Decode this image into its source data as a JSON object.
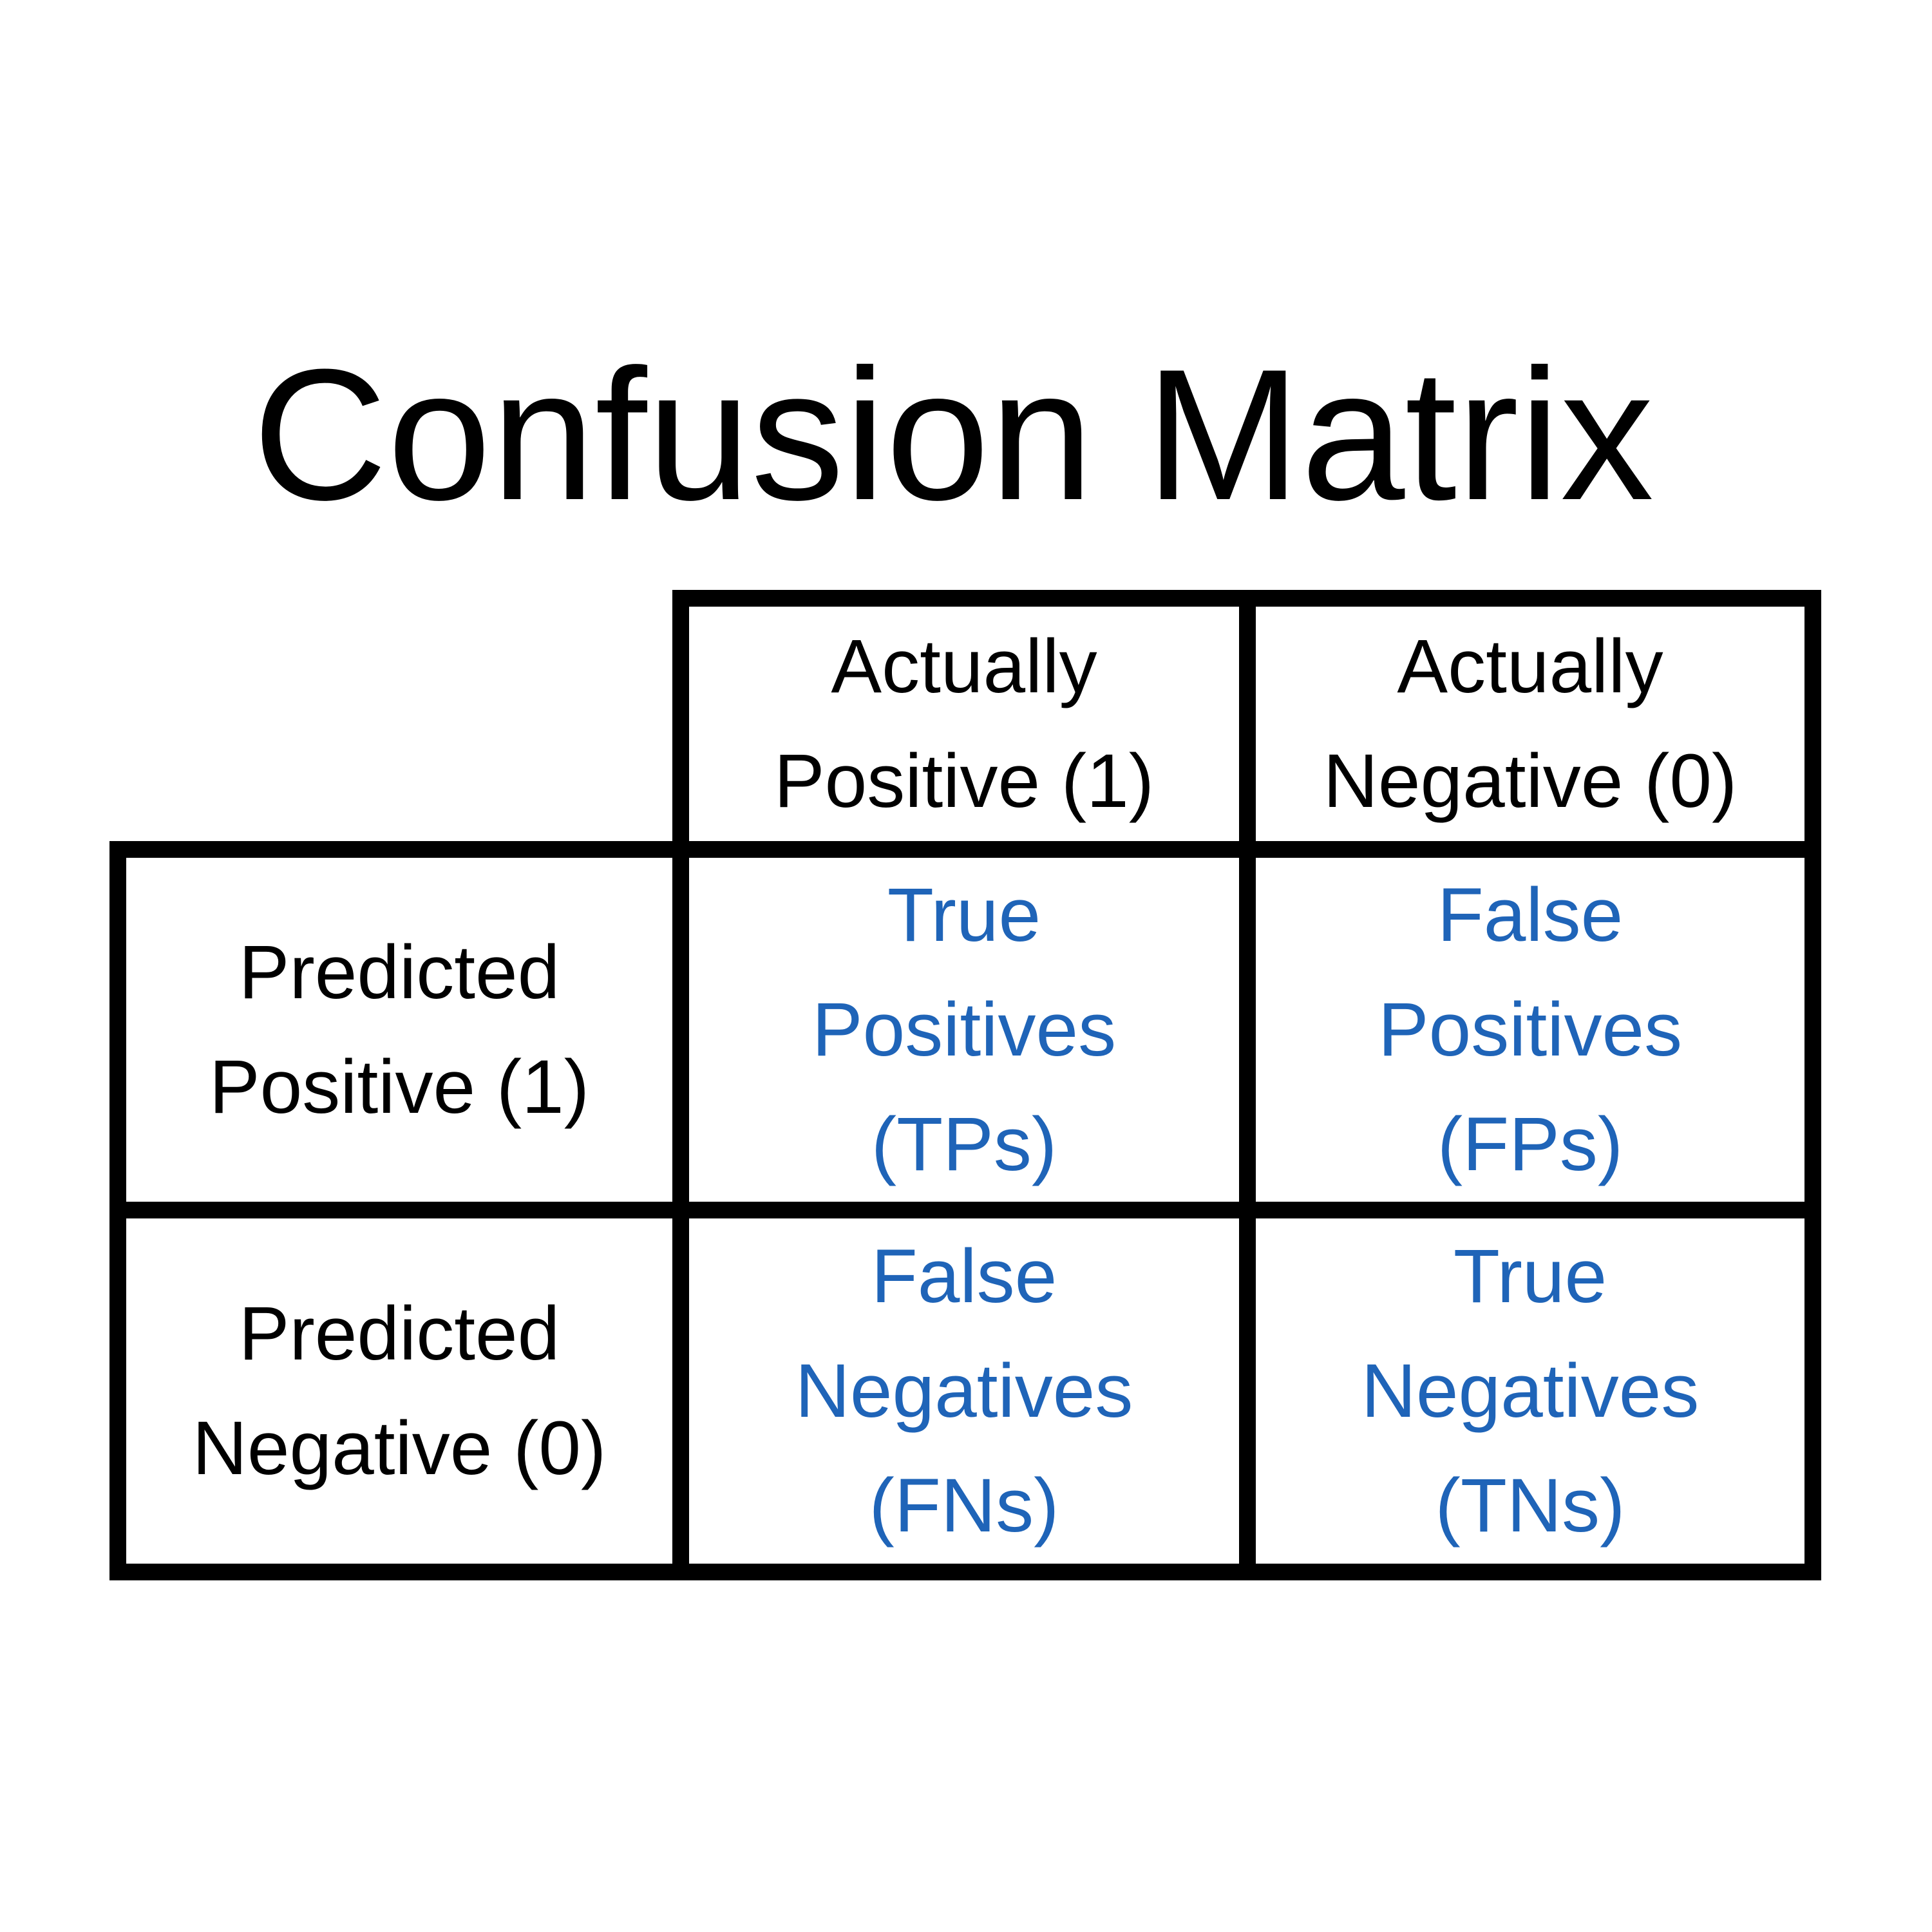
{
  "title": "Confusion Matrix",
  "colors": {
    "grid": "#000000",
    "header_text": "#000000",
    "value_text": "#1F64B8",
    "background": "#FFFFFF"
  },
  "matrix": {
    "column_headers": [
      {
        "lines": [
          "Actually",
          "Positive (1)"
        ]
      },
      {
        "lines": [
          "Actually",
          "Negative (0)"
        ]
      }
    ],
    "row_headers": [
      {
        "lines": [
          "Predicted",
          "Positive (1)"
        ]
      },
      {
        "lines": [
          "Predicted",
          "Negative (0)"
        ]
      }
    ],
    "cells": [
      [
        {
          "lines": [
            "True",
            "Positives",
            "(TPs)"
          ]
        },
        {
          "lines": [
            "False",
            "Positives",
            "(FPs)"
          ]
        }
      ],
      [
        {
          "lines": [
            "False",
            "Negatives",
            "(FNs)"
          ]
        },
        {
          "lines": [
            "True",
            "Negatives",
            "(TNs)"
          ]
        }
      ]
    ]
  }
}
